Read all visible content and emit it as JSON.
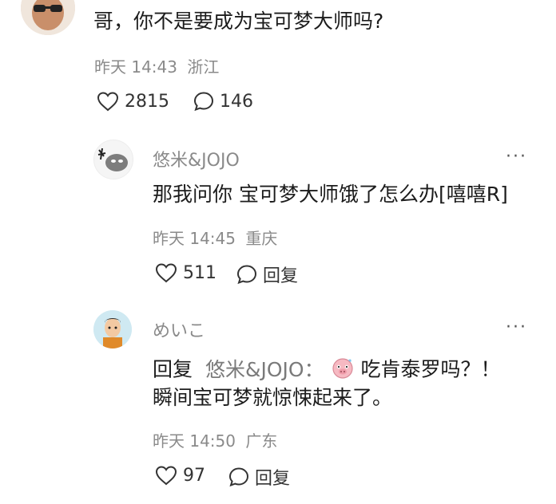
{
  "top_comment": {
    "text": "哥，你不是要成为宝可梦大师吗?",
    "time": "昨天 14:43",
    "location": "浙江",
    "likes": "2815",
    "comments": "146"
  },
  "replies": [
    {
      "username": "悠米&JOJO",
      "text": "那我问你 宝可梦大师饿了怎么办[嘻嘻R]",
      "time": "昨天 14:45",
      "location": "重庆",
      "likes": "511",
      "reply_label": "回复",
      "more_label": "···"
    },
    {
      "username": "めいこ",
      "reply_prefix": "回复",
      "mention": "悠米&JOJO：",
      "text_line1": "吃肯泰罗吗？！",
      "text_line2": "瞬间宝可梦就惊悚起来了。",
      "time": "昨天 14:50",
      "location": "广东",
      "likes": "97",
      "reply_label": "回复",
      "more_label": "···"
    }
  ]
}
